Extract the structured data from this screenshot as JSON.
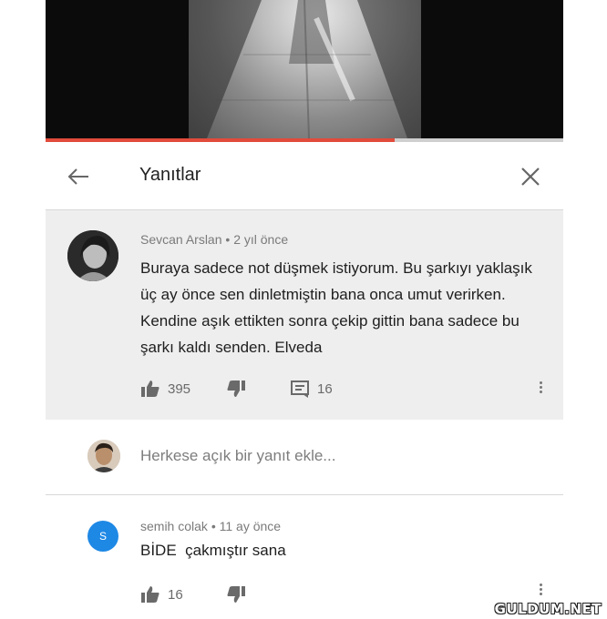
{
  "header": {
    "title": "Yanıtlar",
    "back_icon": "arrow-left-icon",
    "close_icon": "close-icon"
  },
  "video": {
    "progress_fraction": 0.675,
    "progress_color": "#e24b3b"
  },
  "main_comment": {
    "author": "Sevcan Arslan",
    "separator": "•",
    "time": "2 yıl önce",
    "text": "Buraya sadece not düşmek istiyorum. Bu şarkıyı yaklaşık üç ay önce sen dinletmiştin bana onca umut verirken. Kendine aşık ettikten sonra çekip gittin bana sadece bu şarkı kaldı senden. Elveda",
    "likes": "395",
    "replies": "16"
  },
  "reply_input": {
    "placeholder": "Herkese açık bir yanıt ekle..."
  },
  "reply_comment": {
    "author": "semih colak",
    "separator": "•",
    "time": "11 ay önce",
    "avatar_letter": "S",
    "avatar_color": "#1e88e5",
    "text": "BİDE  çakmıştır sana",
    "likes": "16"
  },
  "watermark": "GULDUM.NET"
}
